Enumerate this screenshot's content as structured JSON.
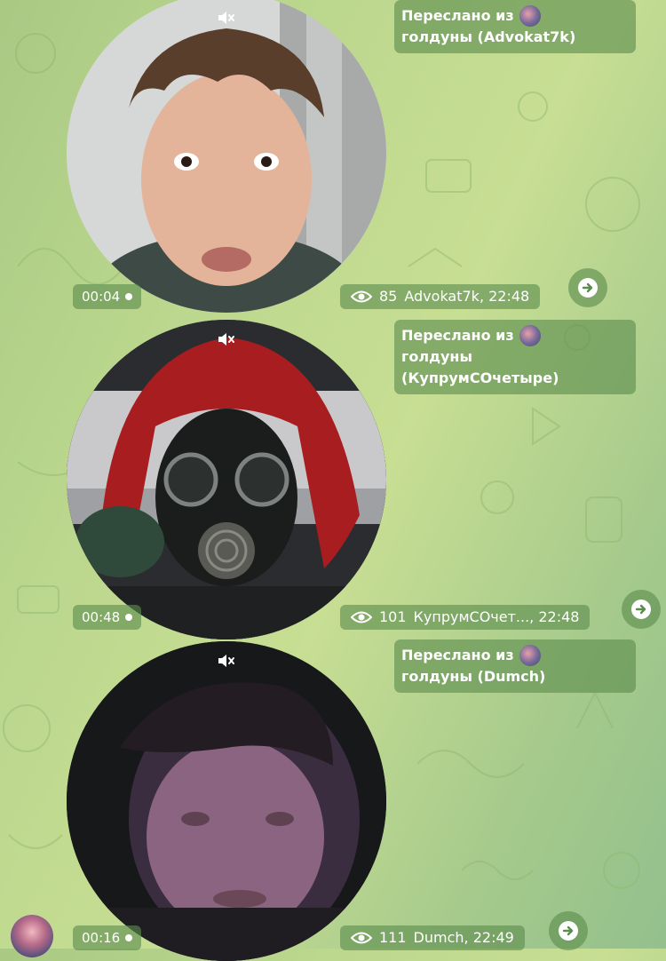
{
  "messages": [
    {
      "forwarded_label": "Переслано из",
      "forwarded_from": "голдуны (Advokat7k)",
      "duration": "00:04",
      "views": "85",
      "author_time": "Advokat7k, 22:48"
    },
    {
      "forwarded_label": "Переслано из",
      "forwarded_from": "голдуны (КупрумСОчетыре)",
      "duration": "00:48",
      "views": "101",
      "author_time": "КупрумСОчет..., 22:48"
    },
    {
      "forwarded_label": "Переслано из",
      "forwarded_from": "голдуны (Dumch)",
      "duration": "00:16",
      "views": "111",
      "author_time": "Dumch, 22:49"
    }
  ],
  "icons": {
    "mute": "muted-speaker-icon",
    "views": "eye-icon",
    "share": "share-arrow-icon"
  },
  "colors": {
    "bubble": "#5c8c4e",
    "text": "#ffffff",
    "background": "#b9d58e"
  }
}
